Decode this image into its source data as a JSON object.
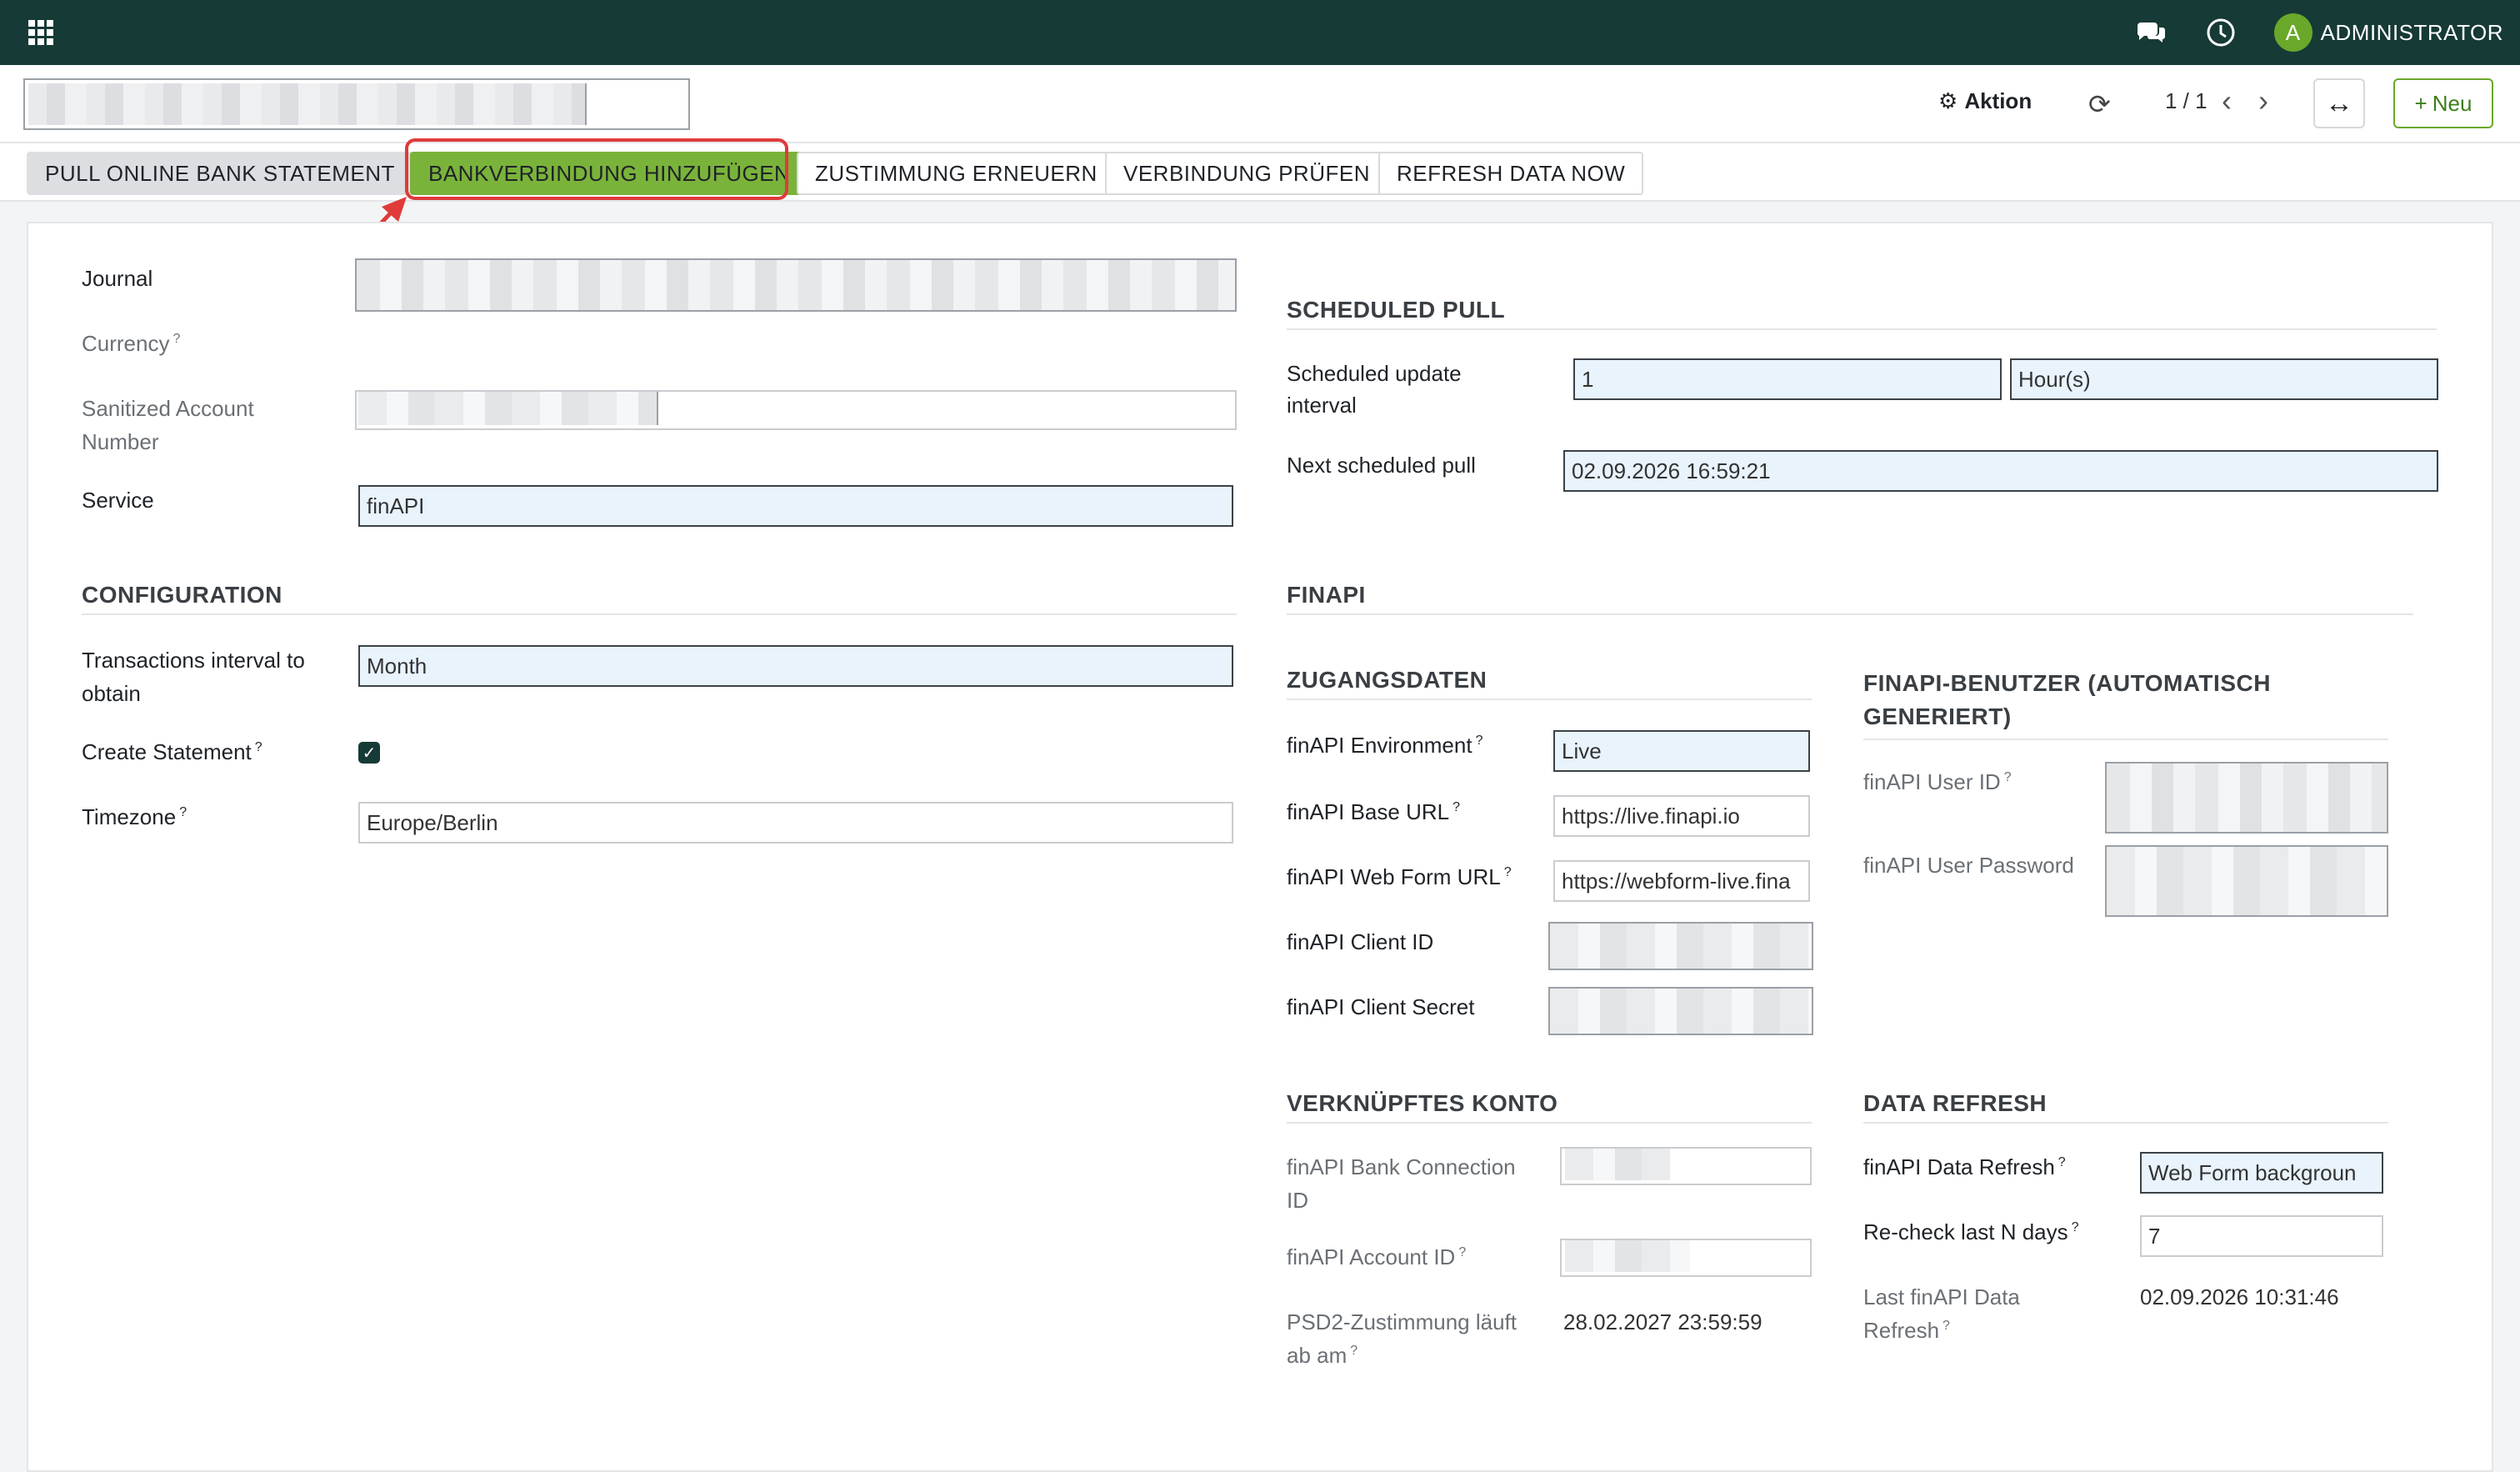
{
  "topbar": {
    "apps_icon": "grid-icon",
    "chat_icon": "chat-icon",
    "clock_icon": "clock-icon",
    "user_initial": "A",
    "user_name": "ADMINISTRATOR",
    "bg_color": "#163a36"
  },
  "control": {
    "aktion_label": "Aktion",
    "pager": "1 / 1",
    "new_label": "Neu"
  },
  "header_buttons": [
    {
      "label": "PULL ONLINE BANK STATEMENT"
    },
    {
      "label": "BANKVERBINDUNG HINZUFÜGEN"
    },
    {
      "label": "ZUSTIMMUNG ERNEUERN"
    },
    {
      "label": "VERBINDUNG PRÜFEN"
    },
    {
      "label": "REFRESH DATA NOW"
    }
  ],
  "left": {
    "journal_label": "Journal",
    "currency_label": "Currency",
    "sanitized_label_1": "Sanitized Account",
    "sanitized_label_2": "Number",
    "service_label": "Service",
    "service_value": "finAPI",
    "configuration_title": "CONFIGURATION",
    "tx_interval_label_1": "Transactions interval to",
    "tx_interval_label_2": "obtain",
    "tx_interval_value": "Month",
    "create_statement_label": "Create Statement",
    "create_statement_checked": true,
    "timezone_label": "Timezone",
    "timezone_value": "Europe/Berlin"
  },
  "scheduled": {
    "title": "SCHEDULED PULL",
    "interval_label_1": "Scheduled update",
    "interval_label_2": "interval",
    "interval_value": "1",
    "interval_unit": "Hour(s)",
    "next_label": "Next scheduled pull",
    "next_value": "02.09.2026 16:59:21"
  },
  "finapi": {
    "title": "FINAPI",
    "zugang_title": "ZUGANGSDATEN",
    "env_label": "finAPI Environment",
    "env_value": "Live",
    "base_url_label": "finAPI Base URL",
    "base_url_value": "https://live.finapi.io",
    "webform_url_label": "finAPI Web Form URL",
    "webform_url_value": "https://webform-live.fina",
    "client_id_label": "finAPI Client ID",
    "client_secret_label": "finAPI Client Secret",
    "user_title_1": "FINAPI-BENUTZER (AUTOMATISCH",
    "user_title_2": "GENERIERT)",
    "user_id_label": "finAPI User ID",
    "user_pw_label": "finAPI User Password",
    "konto_title": "VERKNÜPFTES KONTO",
    "bank_conn_label_1": "finAPI Bank Connection",
    "bank_conn_label_2": "ID",
    "account_id_label": "finAPI Account ID",
    "psd2_label_1": "PSD2-Zustimmung läuft",
    "psd2_label_2": "ab am",
    "psd2_value": "28.02.2027 23:59:59",
    "refresh_title": "DATA REFRESH",
    "data_refresh_label": "finAPI Data Refresh",
    "data_refresh_value": "Web Form backgroun",
    "recheck_label": "Re-check last N days",
    "recheck_value": "7",
    "last_refresh_label_1": "Last finAPI Data",
    "last_refresh_label_2": "Refresh",
    "last_refresh_value": "02.09.2026 10:31:46"
  },
  "tooltip_mark": "?"
}
